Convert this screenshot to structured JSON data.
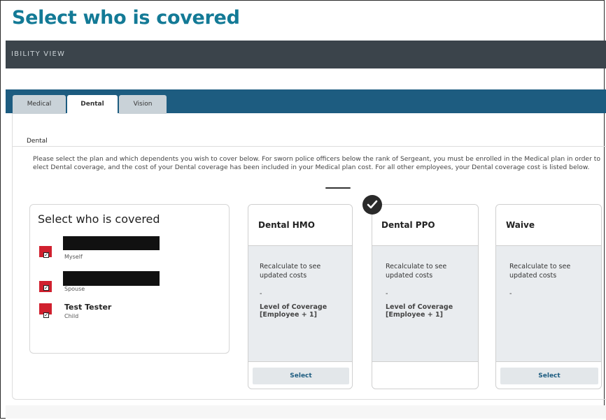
{
  "slide_title": "Select who is covered",
  "nav_bar_text": "IBILITY VIEW",
  "tabs": [
    {
      "label": "Medical",
      "active": false
    },
    {
      "label": "Dental",
      "active": true
    },
    {
      "label": "Vision",
      "active": false
    }
  ],
  "section_heading": "Dental",
  "instructions": "Please select the plan and which dependents you wish to cover below. For sworn police officers below the rank of Sergeant, you must be enrolled in the Medical plan in order to elect Dental coverage, and the cost of your Dental coverage has been included in your Medical plan cost. For all other employees, your Dental coverage cost is listed below.",
  "coverage": {
    "title": "Select who is covered",
    "dependents": [
      {
        "name": "",
        "role": "Myself",
        "checked": true
      },
      {
        "name": "",
        "role": "Spouse",
        "checked": true
      },
      {
        "name": "Test Tester",
        "role": "Child",
        "checked": true
      }
    ]
  },
  "plans": [
    {
      "name": "Dental HMO",
      "cost_text": "Recalculate to see updated costs",
      "dash": "-",
      "level": "Level of Coverage [Employee + 1]",
      "select_label": "Select",
      "selected": false
    },
    {
      "name": "Dental PPO",
      "cost_text": "Recalculate to see updated costs",
      "dash": "-",
      "level": "Level of Coverage [Employee + 1]",
      "select_label": "",
      "selected": true
    },
    {
      "name": "Waive",
      "cost_text": "Recalculate to see updated costs",
      "dash": "-",
      "level": "",
      "select_label": "Select",
      "selected": false
    }
  ],
  "colors": {
    "title": "#137a96",
    "nav": "#3b444b",
    "tabbar": "#1d5c80",
    "checkbox_highlight": "#d0202e"
  },
  "icons": {
    "selected_badge": "checkmark-icon"
  }
}
